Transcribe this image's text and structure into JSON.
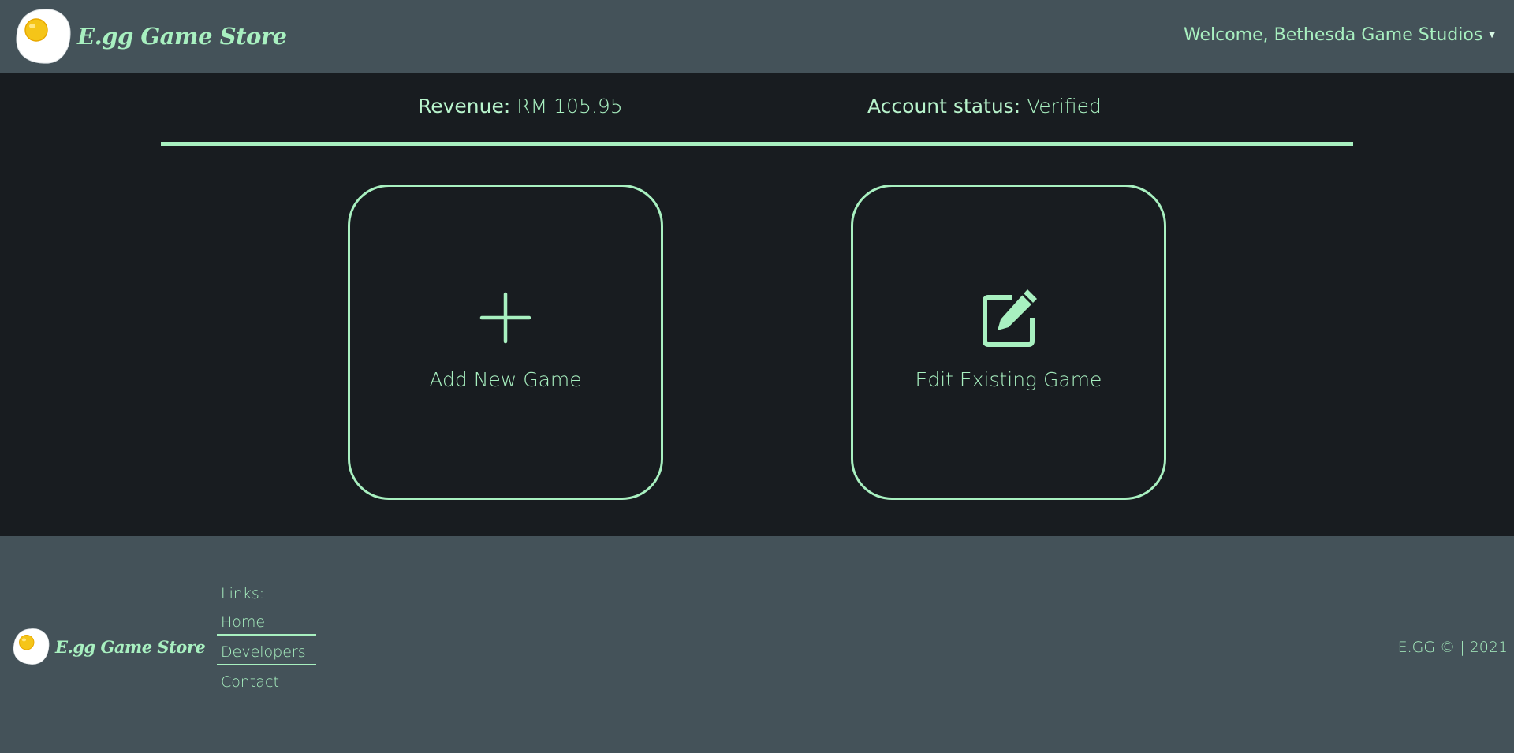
{
  "header": {
    "brand_name": "E.gg Game Store",
    "welcome_text": "Welcome, Bethesda Game Studios"
  },
  "stats": {
    "revenue_label": "Revenue:",
    "revenue_value": "RM 105.95",
    "account_label": "Account status:",
    "account_value": "Verified"
  },
  "actions": {
    "add_label": "Add New Game",
    "edit_label": "Edit Existing Game"
  },
  "footer": {
    "brand_name": "E.gg Game Store",
    "links_title": "Links:",
    "links": [
      "Home",
      "Developers",
      "Contact"
    ],
    "copyright": "E.GG © | 2021"
  },
  "icons": {
    "logo": "fried-egg-icon",
    "add": "plus-icon",
    "edit": "edit-square-icon",
    "dropdown": "caret-down-icon"
  },
  "colors": {
    "accent": "#a8f0c0",
    "header_bg": "#445259",
    "page_bg": "#181c20",
    "egg_yolk": "#f5c518"
  }
}
